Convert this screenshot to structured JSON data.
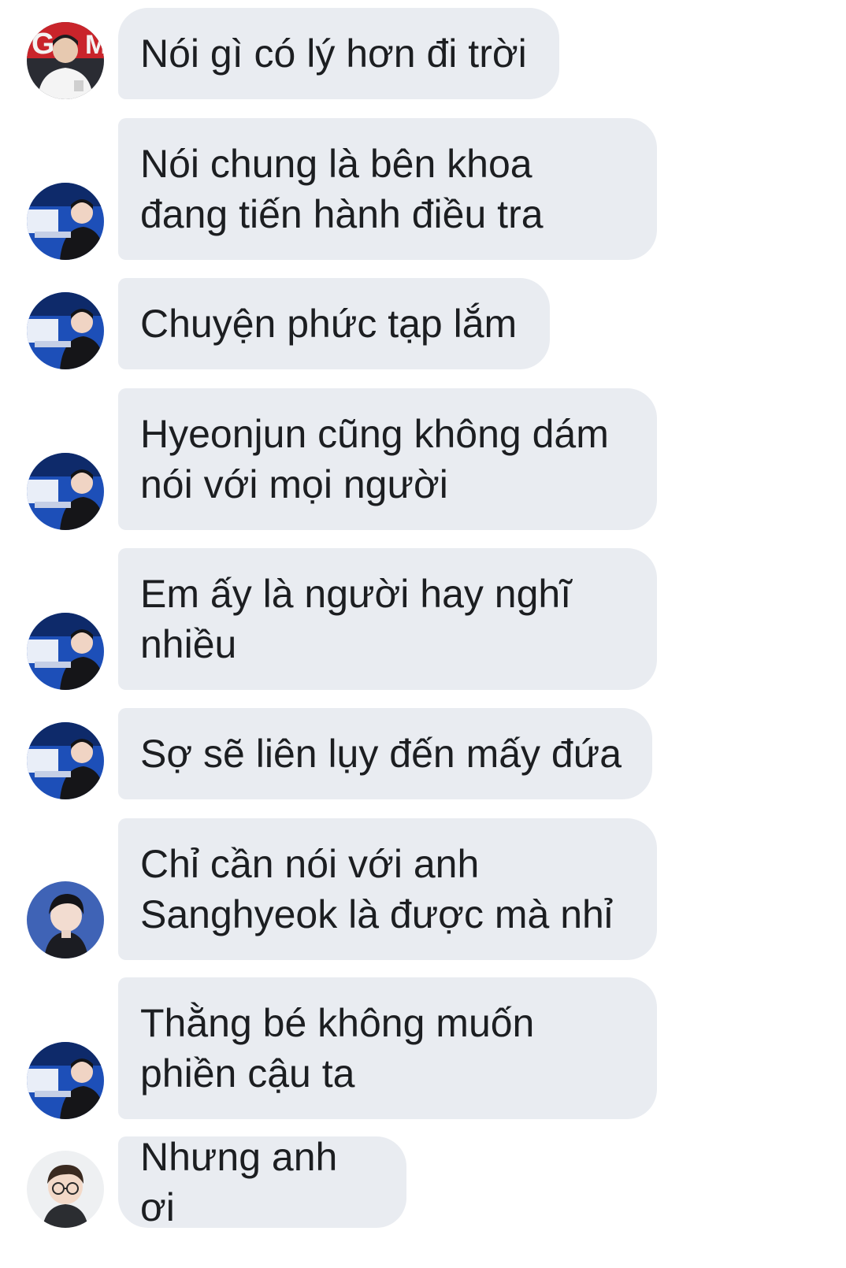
{
  "messages": [
    {
      "text": "Nói gì có lý hơn đi trời",
      "avatar": "avatar-stage-logo"
    },
    {
      "text": "Nói chung là bên khoa\nđang tiến hành điều tra",
      "avatar": "avatar-blue-stage"
    },
    {
      "text": "Chuyện phức tạp lắm",
      "avatar": "avatar-blue-stage"
    },
    {
      "text": "Hyeonjun cũng không dám\nnói với mọi người",
      "avatar": "avatar-blue-stage"
    },
    {
      "text": "Em ấy là người hay nghĩ\nnhiều",
      "avatar": "avatar-blue-stage"
    },
    {
      "text": "Sợ sẽ liên lụy đến mấy đứa",
      "avatar": "avatar-blue-stage"
    },
    {
      "text": "Chỉ cần nói với anh\nSanghyeok là được mà nhỉ",
      "avatar": "avatar-portrait-blue"
    },
    {
      "text": "Thằng bé không muốn\nphiền cậu ta",
      "avatar": "avatar-blue-stage"
    },
    {
      "text": "Nhưng anh ơi",
      "avatar": "avatar-glasses"
    }
  ],
  "colors": {
    "bubble": "#e9ecf1",
    "text": "#1c1e21",
    "background": "#ffffff"
  }
}
